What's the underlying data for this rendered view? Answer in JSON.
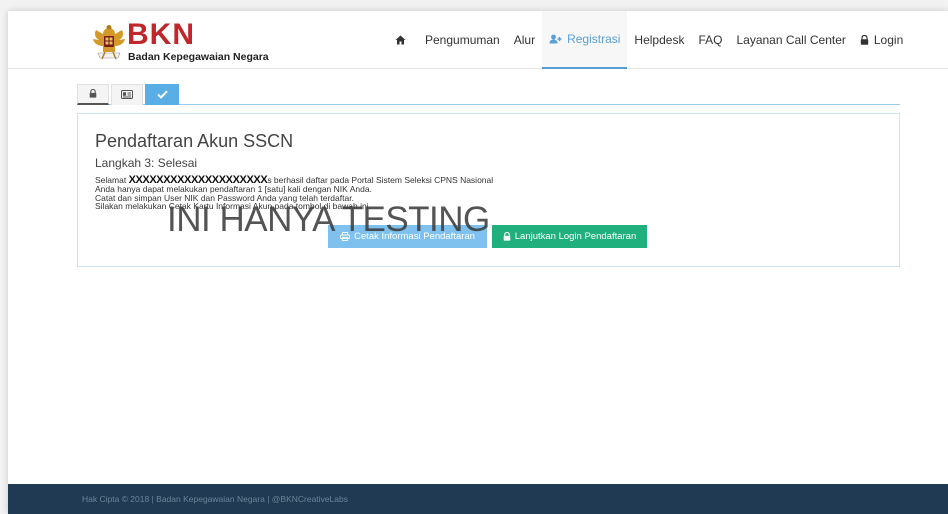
{
  "brand": {
    "logo_text": "BKN",
    "subtitle": "Badan Kepegawaian Negara",
    "emblem_icon": "garuda-emblem-icon"
  },
  "nav": {
    "home_icon": "home-icon",
    "items": [
      {
        "label": "Pengumuman"
      },
      {
        "label": "Alur"
      },
      {
        "label": "Registrasi",
        "icon": "user-plus-icon",
        "active": true
      },
      {
        "label": "Helpdesk"
      },
      {
        "label": "FAQ"
      },
      {
        "label": "Layanan Call Center"
      },
      {
        "label": "Login",
        "icon": "lock-icon"
      }
    ]
  },
  "tabs": [
    {
      "icon": "lock-icon"
    },
    {
      "icon": "id-card-icon"
    },
    {
      "icon": "check-icon",
      "active": true
    }
  ],
  "panel": {
    "title": "Pendaftaran Akun SSCN",
    "subtitle": "Langkah 3: Selesai",
    "line1_prefix": "Selamat",
    "line1_redacted": "XXXXXXXXXXXXXXXXXXXX",
    "line1_suffix": "s berhasil daftar pada Portal Sistem Seleksi CPNS Nasional",
    "line2": "Anda hanya dapat melakukan pendaftaran 1 [satu] kali dengan NIK Anda.",
    "line3": "Catat dan simpan User NIK dan Password Anda yang telah terdaftar.",
    "line4": "Silakan melakukan Cetak Kartu Informasi Akun pada tombol di bawah ini.",
    "watermark": "INI HANYA TESTING",
    "buttons": {
      "print_label": "Cetak Informasi Pendaftaran",
      "login_label": "Lanjutkan Login Pendaftaran"
    }
  },
  "footer": {
    "text": "Hak Cipta © 2018 | Badan Kepegawaian Negara | @BKNCreativeLabs"
  },
  "colors": {
    "brand_red": "#c0272d",
    "accent_blue": "#5aaee6",
    "print_button": "#7fc1ee",
    "login_button": "#20b07e",
    "footer_bg": "#1f3a52"
  }
}
